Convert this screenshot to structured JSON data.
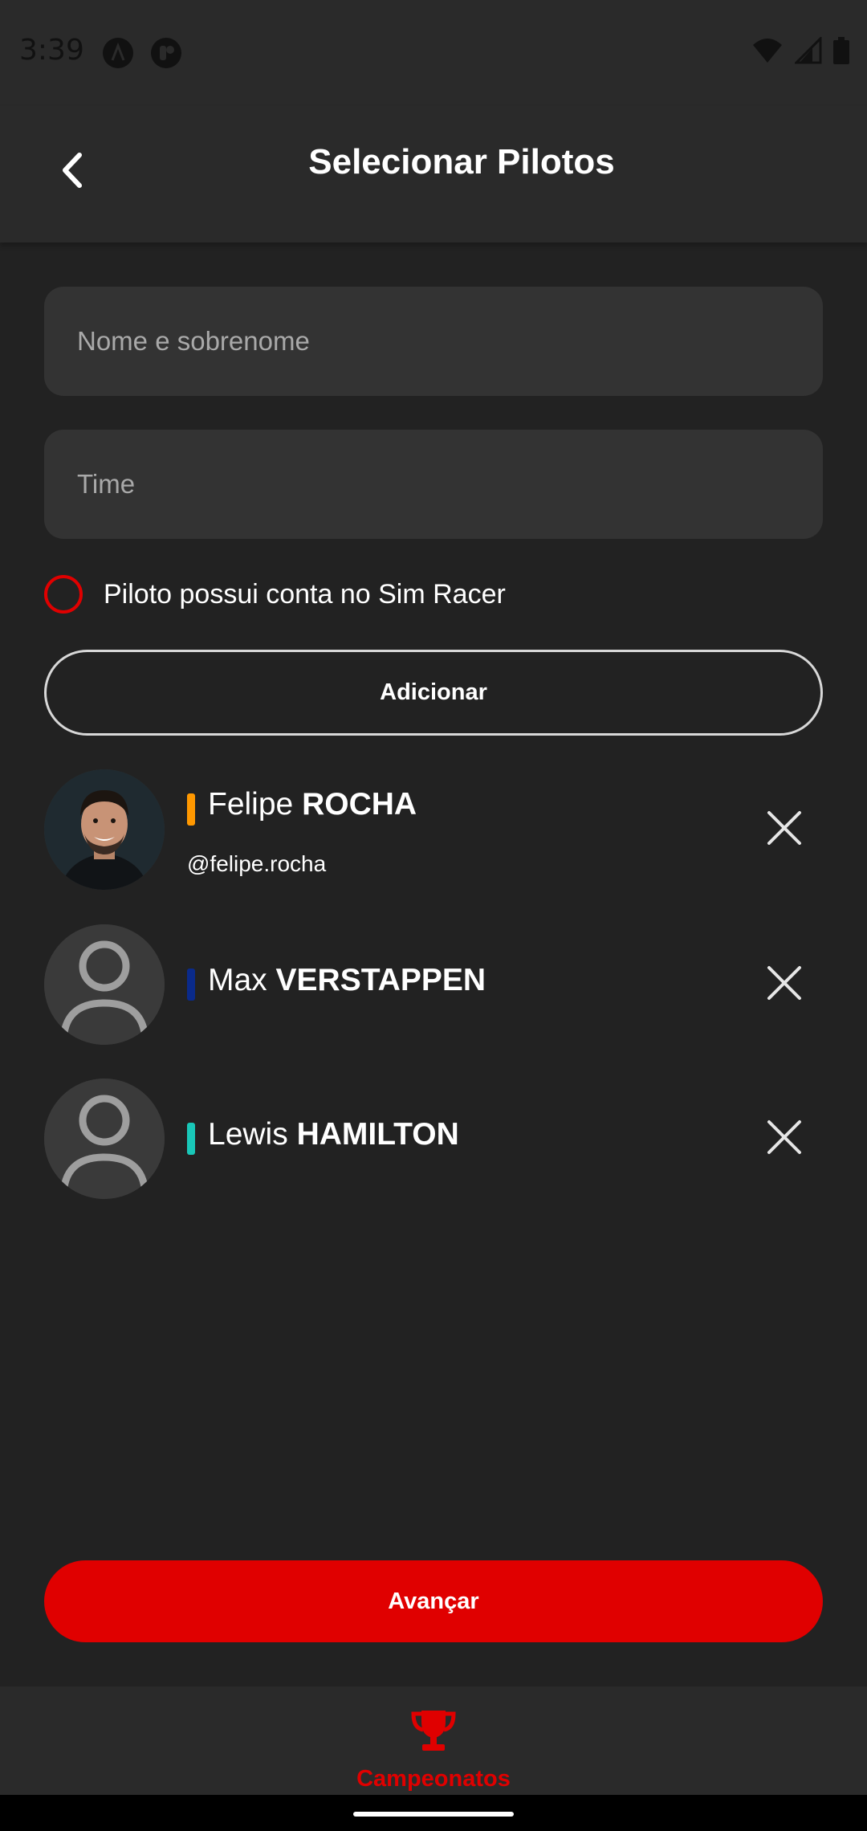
{
  "status_bar": {
    "time": "3:39"
  },
  "header": {
    "title": "Selecionar Pilotos"
  },
  "form": {
    "name_placeholder": "Nome e sobrenome",
    "team_placeholder": "Time",
    "sim_racer_label": "Piloto possui conta no Sim Racer",
    "add_button_label": "Adicionar"
  },
  "drivers": [
    {
      "first_name": "Felipe",
      "last_name": "ROCHA",
      "handle": "@felipe.rocha",
      "team_color": "#ff9800",
      "avatar": "photo"
    },
    {
      "first_name": "Max",
      "last_name": "VERSTAPPEN",
      "handle": "",
      "team_color": "#0a2a8a",
      "avatar": "placeholder-person-icon"
    },
    {
      "first_name": "Lewis",
      "last_name": "HAMILTON",
      "handle": "",
      "team_color": "#19c7b8",
      "avatar": "placeholder-person-icon"
    }
  ],
  "actions": {
    "next_button_label": "Avançar"
  },
  "bottom_nav": {
    "items": [
      {
        "label": "Campeonatos",
        "icon": "trophy-icon",
        "active": true
      }
    ]
  },
  "colors": {
    "accent": "#e00000",
    "background": "#222222",
    "surface": "#2a2a2a",
    "input": "#333333"
  }
}
